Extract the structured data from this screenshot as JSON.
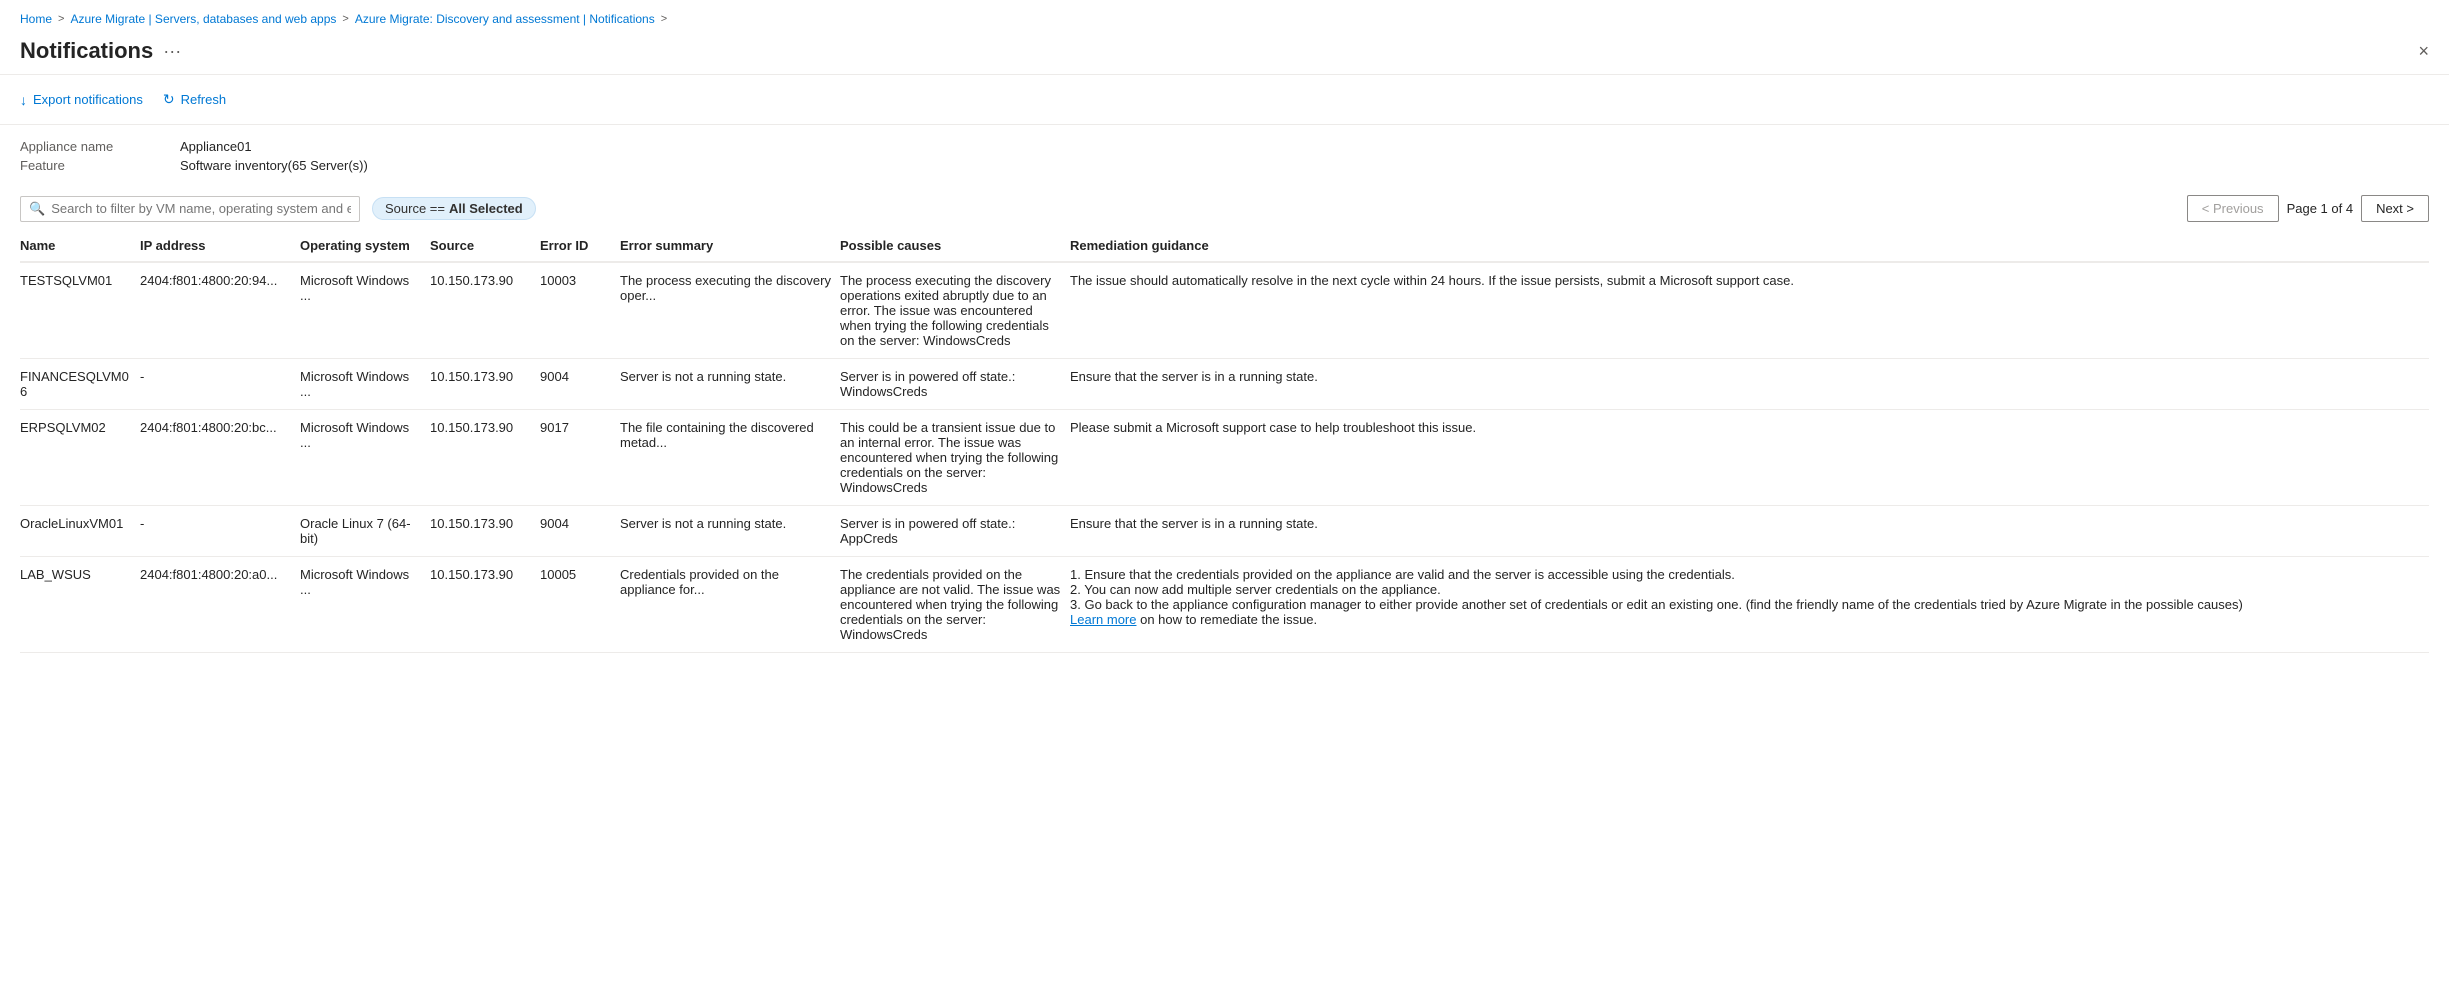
{
  "breadcrumb": {
    "items": [
      {
        "label": "Home",
        "link": true
      },
      {
        "label": "Azure Migrate | Servers, databases and web apps",
        "link": true
      },
      {
        "label": "Azure Migrate: Discovery and assessment | Notifications",
        "link": true
      }
    ],
    "separator": ">"
  },
  "page": {
    "title": "Notifications",
    "more_label": "···",
    "close_label": "×"
  },
  "toolbar": {
    "export_label": "Export notifications",
    "refresh_label": "Refresh",
    "export_icon": "↓",
    "refresh_icon": "↻"
  },
  "meta": {
    "appliance_label": "Appliance name",
    "appliance_value": "Appliance01",
    "feature_label": "Feature",
    "feature_value": "Software inventory(65 Server(s))"
  },
  "filter": {
    "search_placeholder": "Search to filter by VM name, operating system and error ID",
    "source_prefix": "Source ==",
    "source_value": "All Selected"
  },
  "pagination": {
    "previous_label": "< Previous",
    "next_label": "Next >",
    "page_info": "Page 1 of 4"
  },
  "table": {
    "headers": [
      {
        "key": "name",
        "label": "Name"
      },
      {
        "key": "ip",
        "label": "IP address"
      },
      {
        "key": "os",
        "label": "Operating system"
      },
      {
        "key": "source",
        "label": "Source"
      },
      {
        "key": "errorid",
        "label": "Error ID"
      },
      {
        "key": "errorsummary",
        "label": "Error summary"
      },
      {
        "key": "causes",
        "label": "Possible causes"
      },
      {
        "key": "remediation",
        "label": "Remediation guidance"
      }
    ],
    "rows": [
      {
        "name": "TESTSQLVM01",
        "ip": "2404:f801:4800:20:94...",
        "os": "Microsoft Windows ...",
        "source": "10.150.173.90",
        "errorid": "10003",
        "errorsummary": "The process executing the discovery oper...",
        "causes": "The process executing the discovery operations exited abruptly due to an error. The issue was encountered when trying the following credentials on the server: WindowsCreds",
        "remediation": "The issue should automatically resolve in the next cycle within 24 hours. If the issue persists, submit a Microsoft support case."
      },
      {
        "name": "FINANCESQLVM06",
        "ip": "-",
        "os": "Microsoft Windows ...",
        "source": "10.150.173.90",
        "errorid": "9004",
        "errorsummary": "Server is not a running state.",
        "causes": "Server is in powered off state.: WindowsCreds",
        "remediation": "Ensure that the server is in a running state."
      },
      {
        "name": "ERPSQLVM02",
        "ip": "2404:f801:4800:20:bc...",
        "os": "Microsoft Windows ...",
        "source": "10.150.173.90",
        "errorid": "9017",
        "errorsummary": "The file containing the discovered metad...",
        "causes": "This could be a transient issue due to an internal error. The issue was encountered when trying the following credentials on the server: WindowsCreds",
        "remediation": "Please submit a Microsoft support case to help troubleshoot this issue."
      },
      {
        "name": "OracleLinuxVM01",
        "ip": "-",
        "os": "Oracle Linux 7 (64-bit)",
        "source": "10.150.173.90",
        "errorid": "9004",
        "errorsummary": "Server is not a running state.",
        "causes": "Server is in powered off state.: AppCreds",
        "remediation": "Ensure that the server is in a running state."
      },
      {
        "name": "LAB_WSUS",
        "ip": "2404:f801:4800:20:a0...",
        "os": "Microsoft Windows ...",
        "source": "10.150.173.90",
        "errorid": "10005",
        "errorsummary": "Credentials provided on the appliance for...",
        "causes": "The credentials provided on the appliance are not valid. The issue was encountered when trying the following credentials on the server: WindowsCreds",
        "remediation": "1. Ensure that the credentials provided on the appliance are valid and the server is accessible using the credentials.\n2. You can now add multiple server credentials on the appliance.\n3. Go back to the appliance configuration manager to either provide another set of credentials or edit an existing one. (find the friendly name of the credentials tried by Azure Migrate in the possible causes)",
        "remediation_link": "Learn more",
        "remediation_link_suffix": " on how to remediate the issue."
      }
    ]
  }
}
